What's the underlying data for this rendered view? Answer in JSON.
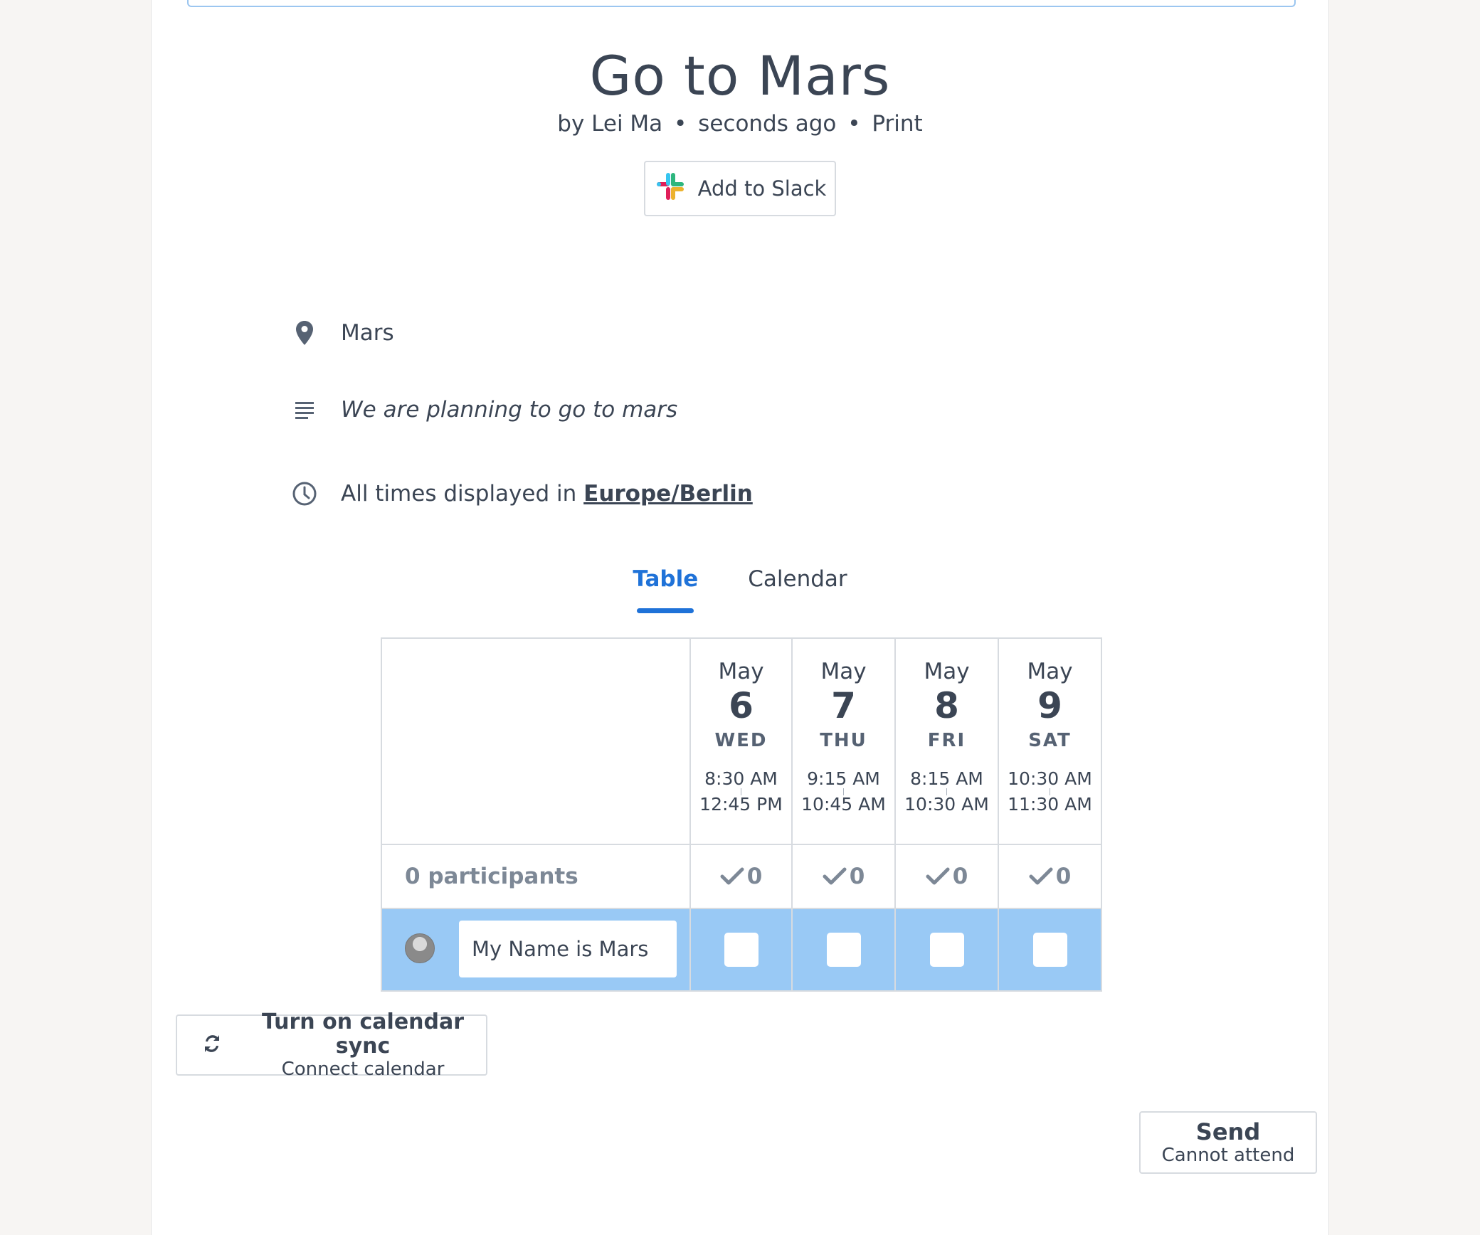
{
  "poll": {
    "title": "Go to Mars",
    "author": "by Lei Ma",
    "created": "seconds ago",
    "print_label": "Print",
    "bullet": "•"
  },
  "slack": {
    "label": "Add to Slack"
  },
  "details": {
    "location": "Mars",
    "description": "We are planning to go to mars",
    "timezone_prefix": "All times displayed in",
    "timezone": "Europe/Berlin"
  },
  "tabs": [
    {
      "label": "Table",
      "active": true
    },
    {
      "label": "Calendar",
      "active": false
    }
  ],
  "options": [
    {
      "month": "May",
      "day": "6",
      "weekday": "WED",
      "start": "8:30 AM",
      "end": "12:45 PM",
      "count": "0"
    },
    {
      "month": "May",
      "day": "7",
      "weekday": "THU",
      "start": "9:15 AM",
      "end": "10:45 AM",
      "count": "0"
    },
    {
      "month": "May",
      "day": "8",
      "weekday": "FRI",
      "start": "8:15 AM",
      "end": "10:30 AM",
      "count": "0"
    },
    {
      "month": "May",
      "day": "9",
      "weekday": "SAT",
      "start": "10:30 AM",
      "end": "11:30 AM",
      "count": "0"
    }
  ],
  "participants_label": "0 participants",
  "name_input": {
    "value": "My Name is Mars"
  },
  "calendar_sync": {
    "title": "Turn on calendar sync",
    "subtitle": "Connect calendar"
  },
  "send": {
    "title": "Send",
    "subtitle": "Cannot attend"
  },
  "colors": {
    "accent": "#1f72d8",
    "row_highlight": "#99c9f5",
    "text": "#3b4554"
  }
}
